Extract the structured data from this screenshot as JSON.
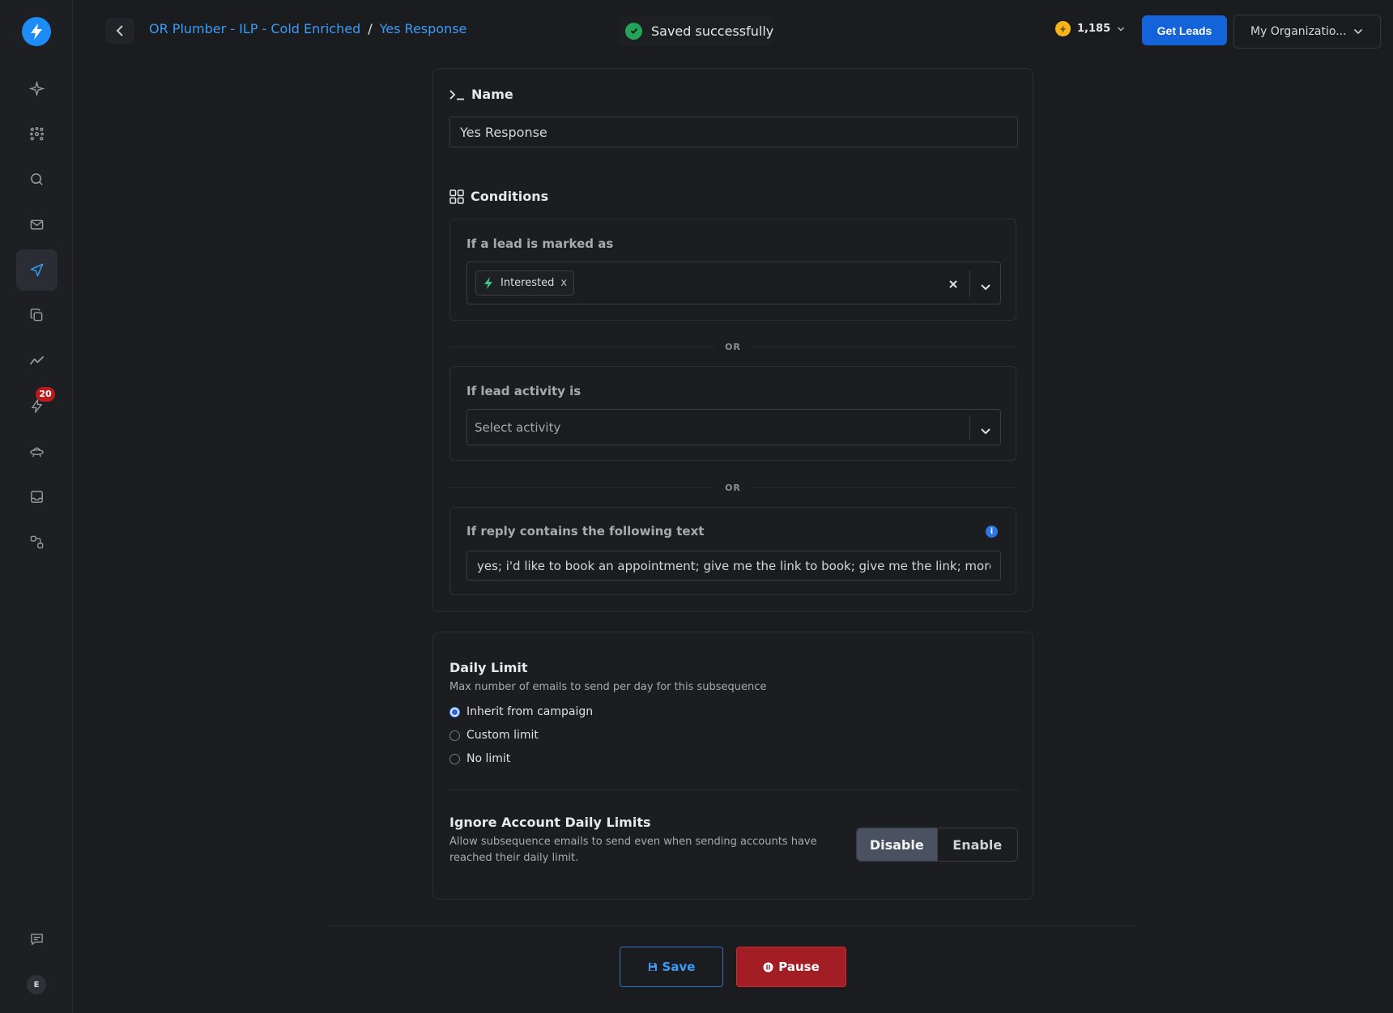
{
  "breadcrumb": {
    "campaign": "OR Plumber - ILP - Cold Enriched",
    "separator": "/",
    "current": "Yes Response"
  },
  "toast": {
    "message": "Saved successfully"
  },
  "header": {
    "credits": "1,185",
    "get_leads": "Get Leads",
    "organization": "My Organizatio..."
  },
  "sidebar": {
    "notifications_badge": "20",
    "avatar_initial": "E"
  },
  "name_section": {
    "title": "Name",
    "value": "Yes Response"
  },
  "conditions": {
    "title": "Conditions",
    "lead_marked_label": "If a lead is marked as",
    "lead_marked_chip": "Interested",
    "chip_remove": "x",
    "or_label": "OR",
    "activity_label": "If lead activity is",
    "activity_placeholder": "Select activity",
    "reply_label": "If reply contains the following text",
    "reply_value": "yes; i'd like to book an appointment; give me the link to book; give me the link; more info"
  },
  "daily_limit": {
    "title": "Daily Limit",
    "description": "Max number of emails to send per day for this subsequence",
    "options": [
      "Inherit from campaign",
      "Custom limit",
      "No limit"
    ],
    "selected": "Inherit from campaign"
  },
  "ignore_limits": {
    "title": "Ignore Account Daily Limits",
    "description": "Allow subsequence emails to send even when sending accounts have reached their daily limit.",
    "disable": "Disable",
    "enable": "Enable",
    "selected": "Disable"
  },
  "footer": {
    "save": "Save",
    "pause": "Pause"
  },
  "colors": {
    "accent": "#3b9cf7",
    "primary_button": "#1463d8",
    "danger": "#a21d24",
    "success": "#22a55a"
  }
}
